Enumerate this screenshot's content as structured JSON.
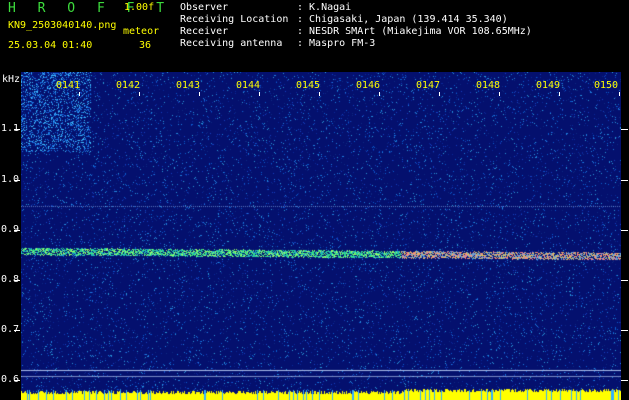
{
  "header": {
    "title": "H R O F F T",
    "version": "1.00f",
    "filename": "KN9_2503040140.png",
    "datetime": "25.03.04 01:40",
    "meteor_label": "meteor",
    "meteor_count": "36",
    "info": [
      {
        "key": "Observer",
        "value": ": K.Nagai"
      },
      {
        "key": "Receiving Location",
        "value": ": Chigasaki, Japan (139.414 35.340)"
      },
      {
        "key": "Receiver",
        "value": ": NESDR SMArt (Miakejima VOR 108.65MHz)"
      },
      {
        "key": "Receiving antenna",
        "value": ": Maspro FM-3"
      }
    ]
  },
  "spectrogram": {
    "y_unit": "kHz",
    "y_ticks": [
      "1.1",
      "1.0",
      "0.9",
      "0.8",
      "0.7",
      "0.6"
    ],
    "x_ticks": [
      "0141",
      "0142",
      "0143",
      "0144",
      "0145",
      "0146",
      "0147",
      "0148",
      "0149",
      "0150"
    ],
    "colors": {
      "background": "#04106e",
      "signal": "#2fe08a",
      "baseline": "#ffff00",
      "labels": "#ffff00"
    }
  }
}
